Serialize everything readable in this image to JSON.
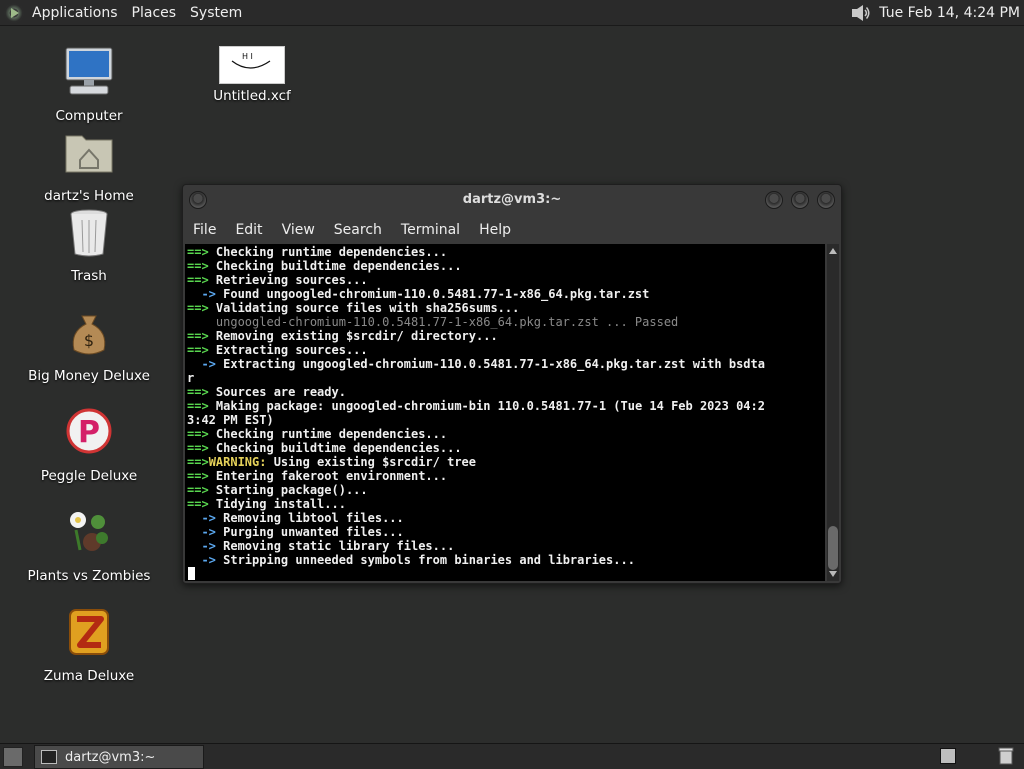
{
  "top_panel": {
    "applications": "Applications",
    "places": "Places",
    "system": "System",
    "clock": "Tue Feb 14,  4:24 PM"
  },
  "desktop": {
    "icons": [
      {
        "label": "Computer",
        "icon": "computer-icon"
      },
      {
        "label": "dartz's Home",
        "icon": "home-folder-icon"
      },
      {
        "label": "Trash",
        "icon": "trash-icon"
      },
      {
        "label": "Big Money Deluxe",
        "icon": "money-bag-icon"
      },
      {
        "label": "Peggle Deluxe",
        "icon": "peggle-icon"
      },
      {
        "label": "Plants vs Zombies",
        "icon": "plants-vs-zombies-icon"
      },
      {
        "label": "Zuma Deluxe",
        "icon": "zuma-icon"
      },
      {
        "label": "Untitled.xcf",
        "icon": "image-file-icon",
        "thumb_text": "H I"
      }
    ]
  },
  "terminal": {
    "title": "dartz@vm3:~",
    "menu": [
      "File",
      "Edit",
      "View",
      "Search",
      "Terminal",
      "Help"
    ],
    "lines": [
      {
        "prefix": "==>",
        "kind": "ar",
        "text": " Checking runtime dependencies..."
      },
      {
        "prefix": "==>",
        "kind": "ar",
        "text": " Checking buildtime dependencies..."
      },
      {
        "prefix": "==>",
        "kind": "ar",
        "text": " Retrieving sources..."
      },
      {
        "prefix": "  ->",
        "kind": "sub",
        "text": " Found ungoogled-chromium-110.0.5481.77-1-x86_64.pkg.tar.zst"
      },
      {
        "prefix": "==>",
        "kind": "ar",
        "text": " Validating source files with sha256sums..."
      },
      {
        "prefix": "",
        "kind": "dim",
        "text": "    ungoogled-chromium-110.0.5481.77-1-x86_64.pkg.tar.zst ... Passed"
      },
      {
        "prefix": "==>",
        "kind": "ar",
        "text": " Removing existing $srcdir/ directory..."
      },
      {
        "prefix": "==>",
        "kind": "ar",
        "text": " Extracting sources..."
      },
      {
        "prefix": "  ->",
        "kind": "sub",
        "text": " Extracting ungoogled-chromium-110.0.5481.77-1-x86_64.pkg.tar.zst with bsdta"
      },
      {
        "prefix": "",
        "kind": "plain",
        "text": "r"
      },
      {
        "prefix": "==>",
        "kind": "ar",
        "text": " Sources are ready."
      },
      {
        "prefix": "==>",
        "kind": "ar",
        "text": " Making package: ungoogled-chromium-bin 110.0.5481.77-1 (Tue 14 Feb 2023 04:2"
      },
      {
        "prefix": "",
        "kind": "plain",
        "text": "3:42 PM EST)"
      },
      {
        "prefix": "==>",
        "kind": "ar",
        "text": " Checking runtime dependencies..."
      },
      {
        "prefix": "==>",
        "kind": "ar",
        "text": " Checking buildtime dependencies..."
      },
      {
        "prefix": "==>",
        "kind": "ar",
        "warn": "WARNING:",
        "text": " Using existing $srcdir/ tree"
      },
      {
        "prefix": "==>",
        "kind": "ar",
        "text": " Entering fakeroot environment..."
      },
      {
        "prefix": "==>",
        "kind": "ar",
        "text": " Starting package()..."
      },
      {
        "prefix": "==>",
        "kind": "ar",
        "text": " Tidying install..."
      },
      {
        "prefix": "  ->",
        "kind": "sub",
        "text": " Removing libtool files..."
      },
      {
        "prefix": "  ->",
        "kind": "sub",
        "text": " Purging unwanted files..."
      },
      {
        "prefix": "  ->",
        "kind": "sub",
        "text": " Removing static library files..."
      },
      {
        "prefix": "  ->",
        "kind": "sub",
        "text": " Stripping unneeded symbols from binaries and libraries..."
      }
    ]
  },
  "bottom_panel": {
    "task_label": "dartz@vm3:~"
  },
  "colors": {
    "desktop_bg": "#2c2d2c",
    "arrow_green": "#59d64f",
    "sub_blue": "#5ba8f0",
    "warning_yellow": "#e6d25a"
  }
}
